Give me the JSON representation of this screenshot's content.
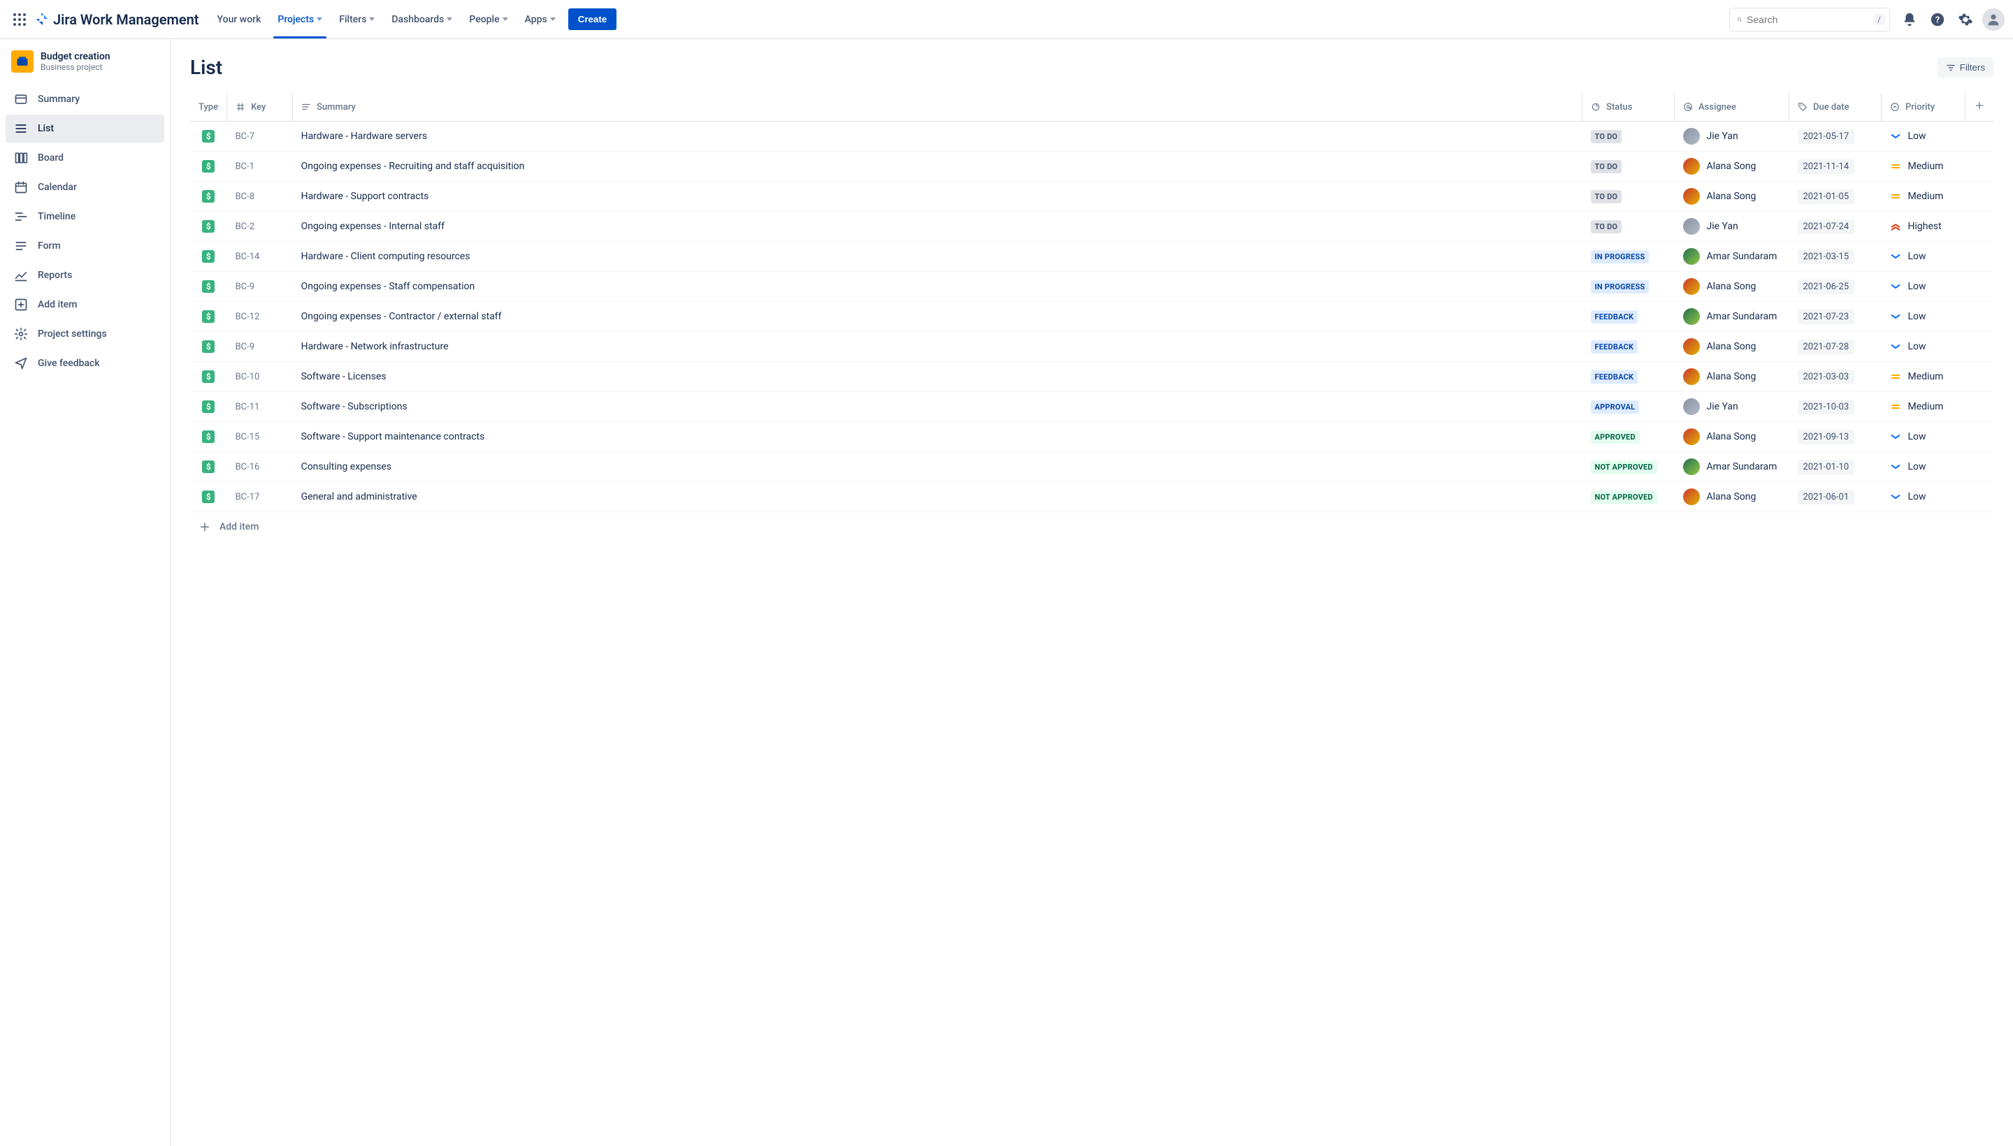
{
  "topnav": {
    "product_name": "Jira Work Management",
    "items": [
      {
        "label": "Your work",
        "caret": false,
        "active": false
      },
      {
        "label": "Projects",
        "caret": true,
        "active": true
      },
      {
        "label": "Filters",
        "caret": true,
        "active": false
      },
      {
        "label": "Dashboards",
        "caret": true,
        "active": false
      },
      {
        "label": "People",
        "caret": true,
        "active": false
      },
      {
        "label": "Apps",
        "caret": true,
        "active": false
      }
    ],
    "create_label": "Create",
    "search_placeholder": "Search",
    "search_kbd": "/"
  },
  "sidebar": {
    "project_name": "Budget creation",
    "project_type": "Business project",
    "items": [
      {
        "label": "Summary",
        "icon": "card-icon",
        "active": false
      },
      {
        "label": "List",
        "icon": "list-icon",
        "active": true
      },
      {
        "label": "Board",
        "icon": "board-icon",
        "active": false
      },
      {
        "label": "Calendar",
        "icon": "calendar-icon",
        "active": false
      },
      {
        "label": "Timeline",
        "icon": "timeline-icon",
        "active": false
      },
      {
        "label": "Form",
        "icon": "form-icon",
        "active": false
      },
      {
        "label": "Reports",
        "icon": "reports-icon",
        "active": false
      },
      {
        "label": "Add item",
        "icon": "add-item-icon",
        "active": false
      },
      {
        "label": "Project settings",
        "icon": "gear-icon",
        "active": false
      },
      {
        "label": "Give feedback",
        "icon": "feedback-icon",
        "active": false
      }
    ]
  },
  "page": {
    "title": "List",
    "filters_label": "Filters",
    "columns": {
      "type": "Type",
      "key": "Key",
      "summary": "Summary",
      "status": "Status",
      "assignee": "Assignee",
      "due_date": "Due date",
      "priority": "Priority"
    },
    "add_item_label": "Add item"
  },
  "assignees": {
    "jie": {
      "name": "Jie Yan",
      "color1": "#8993A4",
      "color2": "#B3BAC5"
    },
    "alana": {
      "name": "Alana Song",
      "color1": "#C9372C",
      "color2": "#E2B203"
    },
    "amar": {
      "name": "Amar Sundaram",
      "color1": "#216E4E",
      "color2": "#94C748"
    }
  },
  "priorities": {
    "low": {
      "label": "Low",
      "color": "#0065FF",
      "kind": "down"
    },
    "medium": {
      "label": "Medium",
      "color": "#FFAB00",
      "kind": "equal"
    },
    "highest": {
      "label": "Highest",
      "color": "#DE350B",
      "kind": "upup"
    }
  },
  "statuses": {
    "todo": {
      "label": "TO DO",
      "class": "status-todo"
    },
    "inprogress": {
      "label": "IN PROGRESS",
      "class": "status-inprogress"
    },
    "feedback": {
      "label": "FEEDBACK",
      "class": "status-feedback"
    },
    "approval": {
      "label": "APPROVAL",
      "class": "status-approval"
    },
    "approved": {
      "label": "APPROVED",
      "class": "status-approved"
    },
    "notapproved": {
      "label": "NOT APPROVED",
      "class": "status-notapproved"
    }
  },
  "rows": [
    {
      "key": "BC-7",
      "summary": "Hardware - Hardware servers",
      "status": "todo",
      "assignee": "jie",
      "due": "2021-05-17",
      "priority": "low"
    },
    {
      "key": "BC-1",
      "summary": "Ongoing expenses - Recruiting and staff acquisition",
      "status": "todo",
      "assignee": "alana",
      "due": "2021-11-14",
      "priority": "medium"
    },
    {
      "key": "BC-8",
      "summary": "Hardware - Support contracts",
      "status": "todo",
      "assignee": "alana",
      "due": "2021-01-05",
      "priority": "medium"
    },
    {
      "key": "BC-2",
      "summary": "Ongoing expenses - Internal staff",
      "status": "todo",
      "assignee": "jie",
      "due": "2021-07-24",
      "priority": "highest"
    },
    {
      "key": "BC-14",
      "summary": "Hardware - Client computing resources",
      "status": "inprogress",
      "assignee": "amar",
      "due": "2021-03-15",
      "priority": "low"
    },
    {
      "key": "BC-9",
      "summary": "Ongoing expenses - Staff compensation",
      "status": "inprogress",
      "assignee": "alana",
      "due": "2021-06-25",
      "priority": "low"
    },
    {
      "key": "BC-12",
      "summary": "Ongoing expenses - Contractor / external staff",
      "status": "feedback",
      "assignee": "amar",
      "due": "2021-07-23",
      "priority": "low"
    },
    {
      "key": "BC-9",
      "summary": "Hardware - Network infrastructure",
      "status": "feedback",
      "assignee": "alana",
      "due": "2021-07-28",
      "priority": "low"
    },
    {
      "key": "BC-10",
      "summary": "Software - Licenses",
      "status": "feedback",
      "assignee": "alana",
      "due": "2021-03-03",
      "priority": "medium"
    },
    {
      "key": "BC-11",
      "summary": "Software - Subscriptions",
      "status": "approval",
      "assignee": "jie",
      "due": "2021-10-03",
      "priority": "medium"
    },
    {
      "key": "BC-15",
      "summary": "Software - Support maintenance contracts",
      "status": "approved",
      "assignee": "alana",
      "due": "2021-09-13",
      "priority": "low"
    },
    {
      "key": "BC-16",
      "summary": "Consulting expenses",
      "status": "notapproved",
      "assignee": "amar",
      "due": "2021-01-10",
      "priority": "low"
    },
    {
      "key": "BC-17",
      "summary": "General and administrative",
      "status": "notapproved",
      "assignee": "alana",
      "due": "2021-06-01",
      "priority": "low"
    }
  ]
}
